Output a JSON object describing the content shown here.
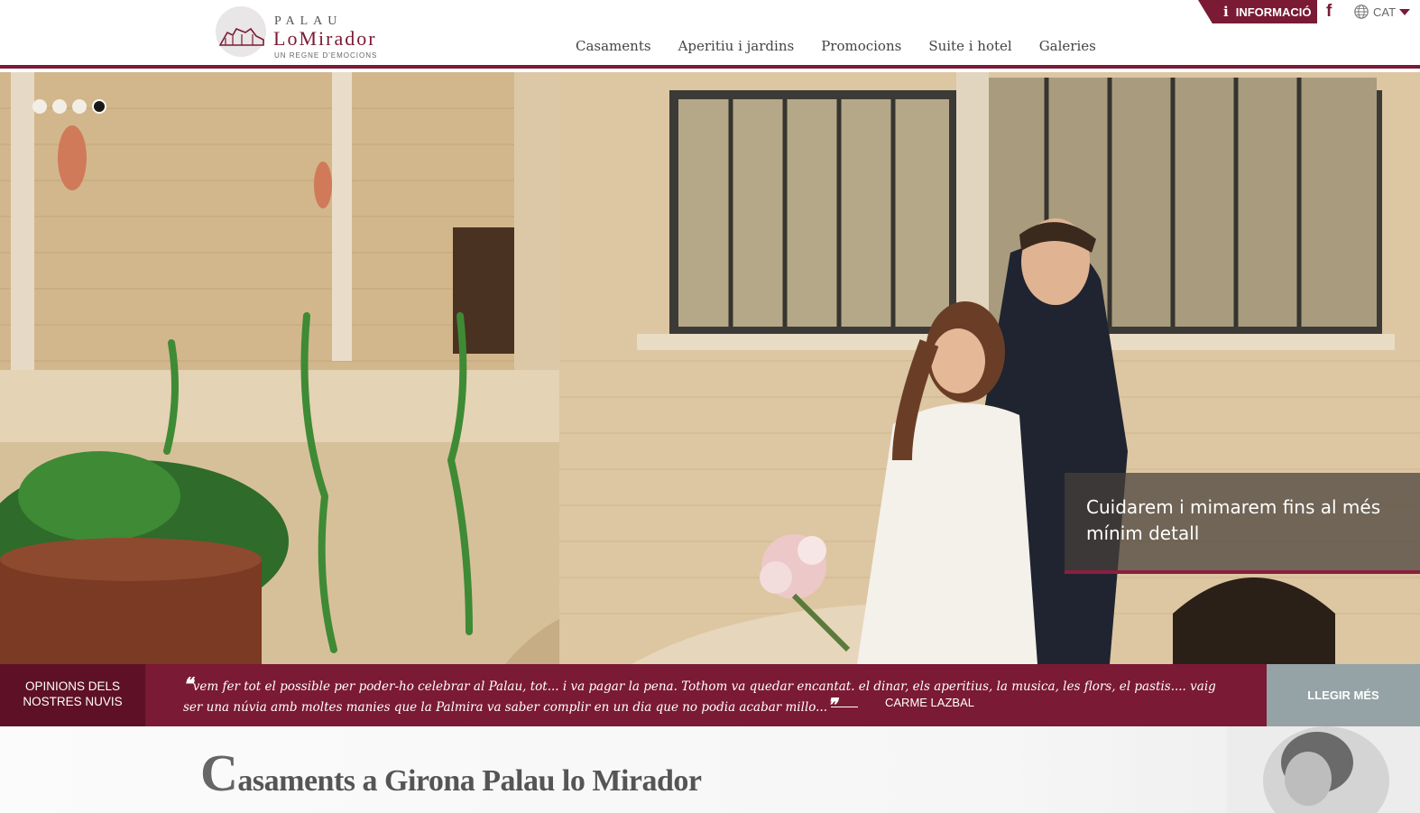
{
  "header": {
    "logo": {
      "line1": "PALAU",
      "line2": "LoMirador",
      "line3": "UN REGNE D'EMOCIONS"
    },
    "nav": [
      {
        "label": "Casaments"
      },
      {
        "label": "Aperitiu i jardins"
      },
      {
        "label": "Promocions"
      },
      {
        "label": "Suite i hotel"
      },
      {
        "label": "Galeries"
      }
    ],
    "info_button": "INFORMACIÓ",
    "language": "CAT"
  },
  "hero": {
    "slider_dots": 4,
    "active_slide": 4,
    "caption": "Cuidarem i mimarem fins al més mínim detall"
  },
  "testimonials": {
    "label_line1": "OPINIONS DELS",
    "label_line2": "NOSTRES NUVIS",
    "quote": "vem fer tot el possible per poder-ho celebrar al Palau, tot... i va pagar la pena. Tothom va quedar encantat. el dinar, els aperitius, la musica, les flors, el pastis.... vaig ser una núvia amb moltes manies que la Palmira va saber complir en un dia que no podia acabar millo...",
    "author": "CARME LAZBAL",
    "read_more": "LLEGIR MÉS"
  },
  "intro": {
    "title_first_letter": "C",
    "title_rest": "asaments a Girona Palau lo Mirador"
  },
  "colors": {
    "brand": "#7a1a35",
    "brand_dark": "#5e1126",
    "read_more_bg": "#95a2a6"
  }
}
